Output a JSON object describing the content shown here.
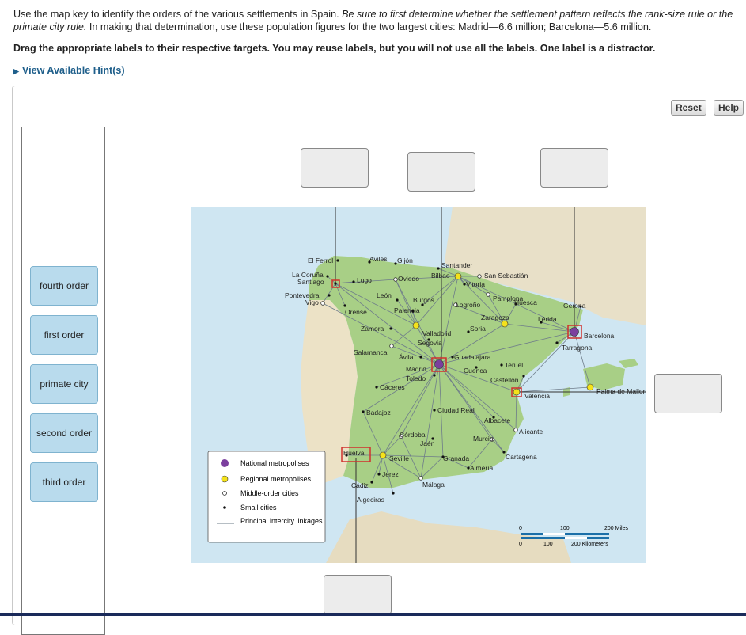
{
  "question": {
    "part1": "Use the map key to identify the orders of the various settlements in Spain.",
    "part2_italic": "Be sure to first determine whether the settlement pattern reflects the rank-size rule or the primate city rule.",
    "part3": "In making that determination, use these population figures for the two largest cities: Madrid—6.6 million; Barcelona—5.6 million."
  },
  "instruction": "Drag the appropriate labels to their respective targets. You may reuse labels, but you will not use all the labels. One label is a distractor.",
  "hint_link": "View Available Hint(s)",
  "buttons": {
    "reset": "Reset",
    "help": "Help"
  },
  "labels": [
    "fourth order",
    "first order",
    "primate city",
    "second order",
    "third order"
  ],
  "map": {
    "cities": {
      "el_ferrol": "El Ferrol",
      "aviles": "Avilés",
      "gijon": "Gijón",
      "santander": "Santander",
      "la_coruna": "La Coruña",
      "santiago": "Santiago",
      "lugo": "Lugo",
      "oviedo": "Oviedo",
      "bilbao": "Bilbao",
      "san_sebastian": "San Sebastián",
      "vitoria": "Vitoria",
      "pontevedra": "Pontevedra",
      "vigo": "Vigo",
      "leon": "León",
      "pamplona": "Pamplona",
      "burgos": "Burgos",
      "logrono": "Logroño",
      "orense": "Orense",
      "palencia": "Palencia",
      "huesca": "Huesca",
      "gerona": "Gerona",
      "zaragoza": "Zaragoza",
      "lerida": "Lérida",
      "zamora": "Zamora",
      "valladolid": "Valladolid",
      "soria": "Soria",
      "barcelona": "Barcelona",
      "segovia": "Segovia",
      "salamanca": "Salamanca",
      "tarragona": "Tarragona",
      "avila": "Ávila",
      "guadalajara": "Guadalajara",
      "madrid": "Madrid",
      "cuenca": "Cuenca",
      "teruel": "Teruel",
      "toledo": "Toledo",
      "castellon": "Castellón",
      "caceres": "Cáceres",
      "valencia": "Valencia",
      "palma": "Palma de Mallorca",
      "badajoz": "Badajoz",
      "ciudad_real": "Ciudad Real",
      "albacete": "Albacete",
      "alicante": "Alicante",
      "cordoba": "Córdoba",
      "jaen": "Jaén",
      "murcia": "Murcia",
      "huelva": "Huelva",
      "seville": "Seville",
      "granada": "Granada",
      "cartagena": "Cartagena",
      "jerez": "Jerez",
      "almeria": "Almería",
      "cadiz": "Cádiz",
      "malaga": "Málaga",
      "algeciras": "Algeciras"
    },
    "legend": [
      "National metropolises",
      "Regional metropolises",
      "Middle-order cities",
      "Small cities",
      "Principal intercity linkages"
    ],
    "scale": {
      "miles_0": "0",
      "miles_100": "100",
      "miles_200": "200 Miles",
      "km_0": "0",
      "km_100": "100",
      "km_200": "200 Kilometers"
    }
  },
  "colors": {
    "national": "#7b3f9e",
    "regional": "#f4e21b",
    "target_border": "#d0312d",
    "label_bg": "#b9dbed"
  }
}
